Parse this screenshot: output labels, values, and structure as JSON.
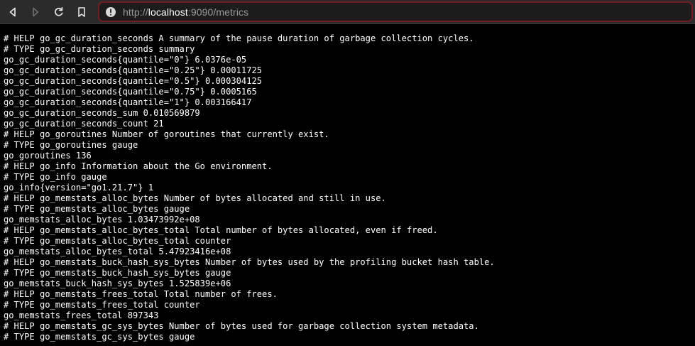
{
  "browser": {
    "url": {
      "scheme": "http://",
      "host": "localhost",
      "rest": ":9090/metrics"
    },
    "icons": {
      "back": "back-arrow-icon",
      "forward": "forward-arrow-icon",
      "reload": "reload-icon",
      "bookmark": "bookmark-icon",
      "site_info": "site-info-icon"
    },
    "colors": {
      "toolbar_bg": "#2b2b2b",
      "urlbar_border": "#6e1f24",
      "page_bg": "#000000",
      "page_text": "#ffffff"
    }
  },
  "metrics": {
    "lines": [
      "# HELP go_gc_duration_seconds A summary of the pause duration of garbage collection cycles.",
      "# TYPE go_gc_duration_seconds summary",
      "go_gc_duration_seconds{quantile=\"0\"} 6.0376e-05",
      "go_gc_duration_seconds{quantile=\"0.25\"} 0.00011725",
      "go_gc_duration_seconds{quantile=\"0.5\"} 0.000304125",
      "go_gc_duration_seconds{quantile=\"0.75\"} 0.0005165",
      "go_gc_duration_seconds{quantile=\"1\"} 0.003166417",
      "go_gc_duration_seconds_sum 0.010569879",
      "go_gc_duration_seconds_count 21",
      "# HELP go_goroutines Number of goroutines that currently exist.",
      "# TYPE go_goroutines gauge",
      "go_goroutines 136",
      "# HELP go_info Information about the Go environment.",
      "# TYPE go_info gauge",
      "go_info{version=\"go1.21.7\"} 1",
      "# HELP go_memstats_alloc_bytes Number of bytes allocated and still in use.",
      "# TYPE go_memstats_alloc_bytes gauge",
      "go_memstats_alloc_bytes 1.03473992e+08",
      "# HELP go_memstats_alloc_bytes_total Total number of bytes allocated, even if freed.",
      "# TYPE go_memstats_alloc_bytes_total counter",
      "go_memstats_alloc_bytes_total 5.47923416e+08",
      "# HELP go_memstats_buck_hash_sys_bytes Number of bytes used by the profiling bucket hash table.",
      "# TYPE go_memstats_buck_hash_sys_bytes gauge",
      "go_memstats_buck_hash_sys_bytes 1.525839e+06",
      "# HELP go_memstats_frees_total Total number of frees.",
      "# TYPE go_memstats_frees_total counter",
      "go_memstats_frees_total 897343",
      "# HELP go_memstats_gc_sys_bytes Number of bytes used for garbage collection system metadata.",
      "# TYPE go_memstats_gc_sys_bytes gauge"
    ]
  }
}
